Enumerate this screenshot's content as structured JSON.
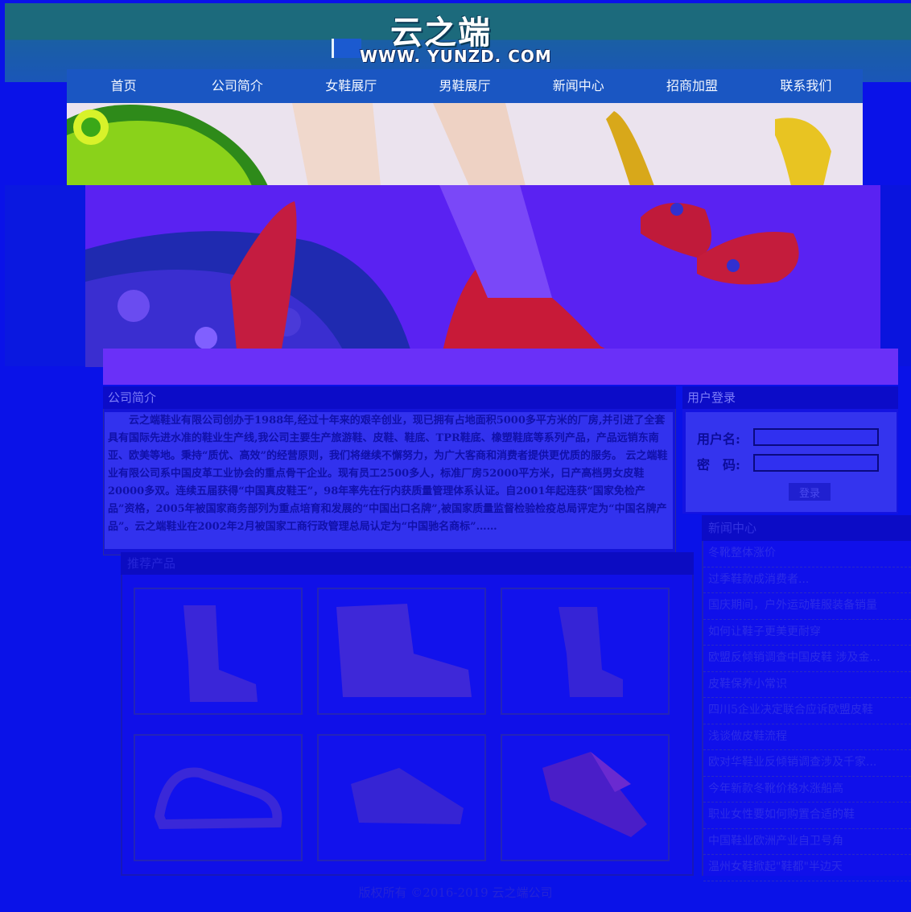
{
  "header": {
    "logo": "云之端",
    "url": "WWW. YUNZD. COM"
  },
  "nav": {
    "items": [
      "首页",
      "公司简介",
      "女鞋展厅",
      "男鞋展厅",
      "新闻中心",
      "招商加盟",
      "联系我们"
    ]
  },
  "about": {
    "title": "公司简介",
    "text": "云之端鞋业有限公司创办于1988年,经过十年来的艰辛创业，现已拥有占地面积5000多平方米的厂房,并引进了全套具有国际先进水准的鞋业生产线,我公司主要生产旅游鞋、皮鞋、鞋底、TPR鞋底、橡塑鞋底等系列产品，产品远销东南亚、欧美等地。秉持“质优、高效”的经营原则，我们将继续不懈努力，为广大客商和消费者提供更优质的服务。 云之端鞋业有限公司系中国皮革工业协会的重点骨干企业。现有员工2500多人，标准厂房52000平方米，日产高档男女皮鞋20000多双。连续五届获得“中国真皮鞋王”，98年率先在行内获质量管理体系认证。自2001年起连获“国家免检产品”资格，2005年被国家商务部列为重点培育和发展的“中国出口名牌”,被国家质量监督检验检疫总局评定为“中国名牌产品”。云之端鞋业在2002年2月被国家工商行政管理总局认定为“中国驰名商标”……"
  },
  "login": {
    "title": "用户登录",
    "username_label": "用户名:",
    "password_label": "密　码:",
    "submit_label": "登录"
  },
  "products": {
    "title": "推荐产品"
  },
  "news": {
    "title": "新闻中心",
    "items": [
      "冬靴整体涨价",
      "过季鞋款成消费者...",
      "国庆期间，户外运动鞋服装备销量",
      "如何让鞋子更美更耐穿",
      "欧盟反倾销调查中国皮鞋 涉及金...",
      "皮鞋保养小常识",
      "四川5企业决定联合应诉欧盟皮鞋",
      "浅谈做皮鞋流程",
      "欧对华鞋业反倾销调查涉及千家...",
      "今年新款冬靴价格水涨船高",
      "职业女性要如何购置合适的鞋",
      "中国鞋业欧洲产业自卫号角",
      "温州女鞋掀起\"鞋都\"半边天"
    ]
  },
  "footer": {
    "copyright": "版权所有 ©2016-2019 云之端公司"
  },
  "colors": {
    "page_bg": "#0a12e8",
    "header_teal": "#1c6a7c",
    "nav_blue": "#1a56c2",
    "banner_violet": "#5a22f2"
  }
}
